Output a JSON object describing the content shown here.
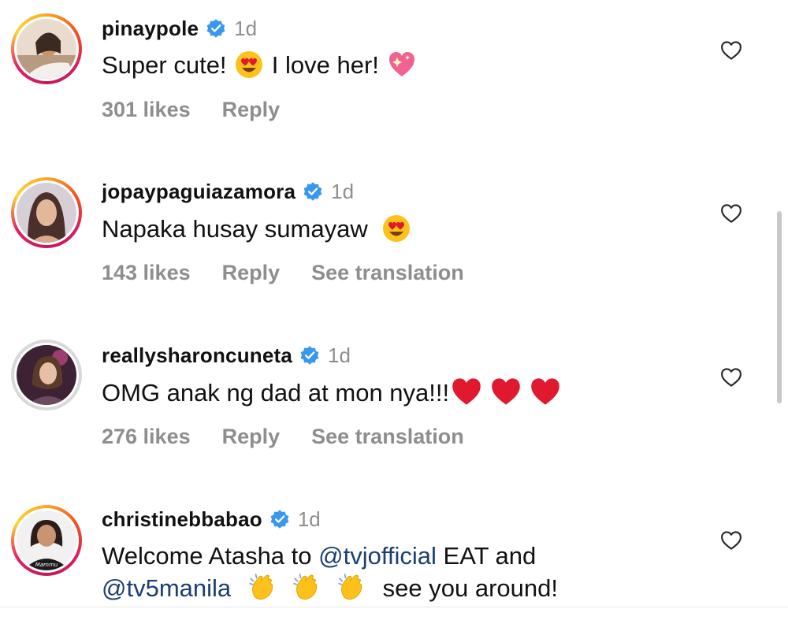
{
  "comments": [
    {
      "username": "pinaypole",
      "time": "1d",
      "text_parts": [
        "Super cute!",
        "I love her!"
      ],
      "likes": "301 likes",
      "reply": "Reply",
      "see_translation": ""
    },
    {
      "username": "jopaypaguiazamora",
      "time": "1d",
      "text_parts": [
        "Napaka husay sumayaw"
      ],
      "likes": "143 likes",
      "reply": "Reply",
      "see_translation": "See translation"
    },
    {
      "username": "reallysharoncuneta",
      "time": "1d",
      "text_parts": [
        "OMG anak ng dad at mon nya!!!"
      ],
      "likes": "276 likes",
      "reply": "Reply",
      "see_translation": "See translation"
    },
    {
      "username": "christinebbabao",
      "time": "1d",
      "line1_parts": [
        "Welcome Atasha to ",
        "@tvjofficial",
        " EAT and"
      ],
      "line2_parts": [
        "@tv5manila",
        "see you around!"
      ],
      "avatar_shirt_text": "Mammu"
    }
  ],
  "colors": {
    "verified_badge": "#3897f0",
    "muted_text": "#8e8e8e",
    "mention": "#1b3f73",
    "heart_emoji": "#e0192f"
  },
  "icons": [
    "verified-badge-icon",
    "heart-outline-icon",
    "heart-eyes-emoji",
    "sparkling-heart-emoji",
    "red-heart-emoji",
    "clapping-hands-emoji"
  ]
}
